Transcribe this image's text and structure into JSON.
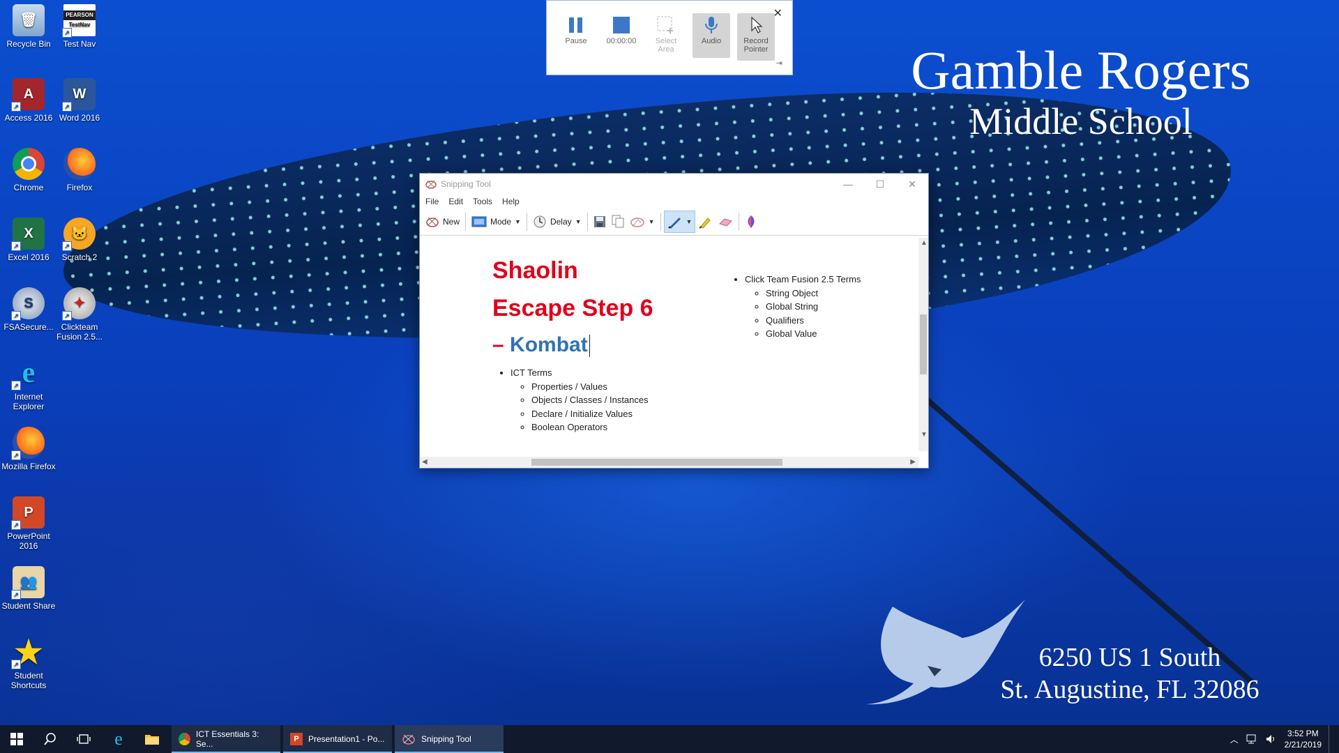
{
  "desktop": {
    "icons": [
      {
        "label": "Recycle Bin",
        "icon": "recycle-bin-icon"
      },
      {
        "label": "Test Nav",
        "icon": "testnav-icon",
        "badge_top": "PEARSON",
        "badge_text": "TestNav"
      },
      {
        "label": "Access 2016",
        "icon": "access-icon"
      },
      {
        "label": "Word 2016",
        "icon": "word-icon"
      },
      {
        "label": "Chrome",
        "icon": "chrome-icon"
      },
      {
        "label": "Firefox",
        "icon": "firefox-icon"
      },
      {
        "label": "Excel 2016",
        "icon": "excel-icon"
      },
      {
        "label": "Scratch 2",
        "icon": "scratch-icon"
      },
      {
        "label": "FSASecure...",
        "icon": "fsasecure-icon"
      },
      {
        "label": "Clickteam Fusion 2.5...",
        "icon": "clickteam-icon"
      },
      {
        "label": "Internet Explorer",
        "icon": "internet-explorer-icon"
      },
      {
        "label": "Mozilla Firefox",
        "icon": "mozilla-firefox-icon"
      },
      {
        "label": "PowerPoint 2016",
        "icon": "powerpoint-icon"
      },
      {
        "label": "Student Share",
        "icon": "student-share-icon"
      },
      {
        "label": "Student Shortcuts",
        "icon": "star-icon"
      }
    ],
    "wallpaper": {
      "school_line1": "Gamble Rogers",
      "school_line2": "Middle School",
      "address_line1": "6250 US 1 South",
      "address_line2": "St. Augustine, FL 32086"
    }
  },
  "recorder": {
    "pause_label": "Pause",
    "timer": "00:00:00",
    "select_area_label": "Select Area",
    "audio_label": "Audio",
    "record_pointer_label": "Record Pointer",
    "close": "✕",
    "pin": "⇥"
  },
  "snipping_tool": {
    "title": "Snipping Tool",
    "controls": {
      "minimize": "—",
      "maximize": "☐",
      "close": "✕"
    },
    "menu": [
      "File",
      "Edit",
      "Tools",
      "Help"
    ],
    "toolbar": {
      "new_label": "New",
      "mode_label": "Mode",
      "delay_label": "Delay"
    },
    "slide": {
      "title_line1": "Shaolin",
      "title_line2": "Escape Step 6",
      "title_dash": "–",
      "title_line3": "Kombat",
      "left_bullet": "ICT Terms",
      "left_sub": [
        "Properties / Values",
        "Objects / Classes / Instances",
        "Declare / Initialize Values",
        "Boolean Operators"
      ],
      "right_bullet": "Click Team Fusion 2.5 Terms",
      "right_sub": [
        "String Object",
        "Global String",
        "Qualifiers",
        "Global Value"
      ]
    }
  },
  "taskbar": {
    "apps": [
      {
        "label": "ICT Essentials 3: Se...",
        "icon": "chrome-icon"
      },
      {
        "label": "Presentation1 - Po...",
        "icon": "powerpoint-icon"
      },
      {
        "label": "Snipping Tool",
        "icon": "snipping-tool-icon"
      }
    ],
    "time": "3:52 PM",
    "date": "2/21/2019"
  },
  "colors": {
    "accent_red": "#e0001b",
    "accent_blue": "#2e74b5",
    "taskbar": "#101a2c"
  }
}
